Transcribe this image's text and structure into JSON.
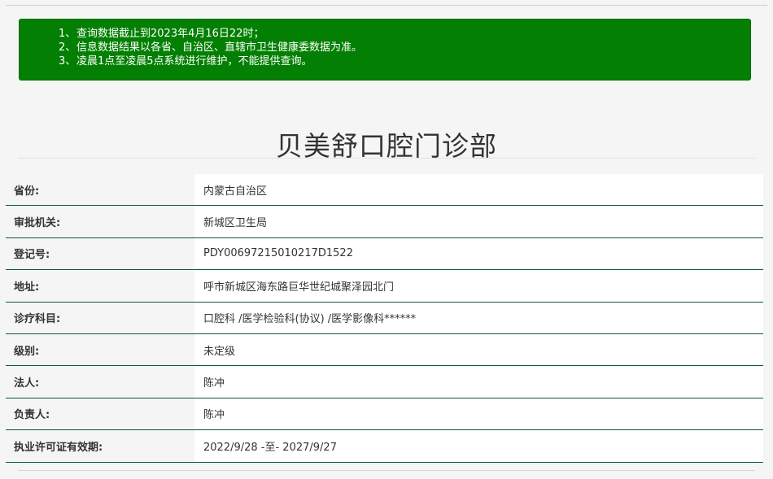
{
  "notice": {
    "lines": [
      {
        "num": "1、",
        "text": "查询数据截止到2023年4月16日22时；"
      },
      {
        "num": "2、",
        "text": "信息数据结果以各省、自治区、直辖市卫生健康委数据为准。"
      },
      {
        "num": "3、",
        "text": "凌晨1点至凌晨5点系统进行维护，不能提供查询。"
      }
    ],
    "bg_color": "#038003"
  },
  "page_title": "贝美舒口腔门诊部",
  "info_rows": [
    {
      "label": "省份:",
      "value": "内蒙古自治区"
    },
    {
      "label": "审批机关:",
      "value": "新城区卫生局"
    },
    {
      "label": "登记号:",
      "value": "PDY00697215010217D1522"
    },
    {
      "label": "地址:",
      "value": "呼市新城区海东路巨华世纪城聚泽园北门"
    },
    {
      "label": "诊疗科目:",
      "value": "口腔科 /医学检验科(协议) /医学影像科******"
    },
    {
      "label": "级别:",
      "value": "未定级"
    },
    {
      "label": "法人:",
      "value": "陈冲"
    },
    {
      "label": "负责人:",
      "value": "陈冲"
    },
    {
      "label": "执业许可证有效期:",
      "value": "2022/9/28 -至- 2027/9/27"
    }
  ],
  "colors": {
    "row_divider": "#0c5a2e",
    "page_bg": "#f5f5f5"
  }
}
